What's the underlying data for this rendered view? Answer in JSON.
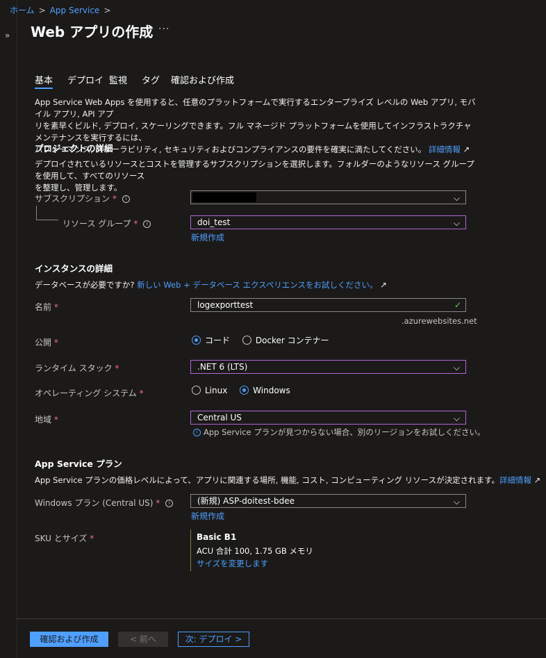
{
  "breadcrumb": {
    "home": "ホーム",
    "app_service": "App Service",
    "sep": ">"
  },
  "page": {
    "title": "Web アプリの作成",
    "more": "···"
  },
  "tabs": [
    {
      "label": "基本",
      "selected": true
    },
    {
      "label": "デプロイ"
    },
    {
      "label": "監視"
    },
    {
      "label": "タグ"
    },
    {
      "label": "確認および作成"
    }
  ],
  "intro": {
    "line1": "App Service Web Apps を使用すると、任意のプラットフォームで実行するエンタープライズ レベルの Web アプリ, モバイル アプリ, API アプ",
    "line2": "リを素早くビルド, デプロイ, スケーリングできます。フル マネージド プラットフォームを使用してインフラストラクチャ メンテナンスを実行するには、",
    "line3": "パフォーマンス, スケーラビリティ, セキュリティおよびコンプライアンスの要件を確実に満たしてください。",
    "learn_more": "詳細情報",
    "ext_icon": "↗"
  },
  "project": {
    "heading": "プロジェクトの詳細",
    "desc1": "デプロイされているリソースとコストを管理するサブスクリプションを選択します。フォルダーのようなリソース グループを使用して、すべてのリソース",
    "desc2": "を整理し、管理します。",
    "subscription_label": "サブスクリプション",
    "resource_group_label": "リソース グループ",
    "resource_group_value": "doi_test",
    "create_new": "新規作成"
  },
  "instance": {
    "heading": "インスタンスの詳細",
    "db_prompt": "データベースが必要ですか?",
    "db_link": "新しい Web + データベース エクスペリエンスをお試しください。",
    "name_label": "名前",
    "name_value": "logexporttest",
    "name_suffix": ".azurewebsites.net",
    "publish_label": "公開",
    "publish_options": [
      "コード",
      "Docker コンテナー"
    ],
    "runtime_label": "ランタイム スタック",
    "runtime_value": ".NET 6 (LTS)",
    "os_label": "オペレーティング システム",
    "os_options": [
      "Linux",
      "Windows"
    ],
    "region_label": "地域",
    "region_value": "Central US",
    "region_hint": "App Service プランが見つからない場合、別のリージョンをお試しください。"
  },
  "plan": {
    "heading": "App Service プラン",
    "desc": "App Service プランの価格レベルによって、アプリに関連する場所, 機能, コスト, コンピューティング リソースが決定されます。",
    "learn_more": "詳細情報",
    "windows_plan_label": "Windows プラン (Central US)",
    "windows_plan_value": "(新規) ASP-doitest-bdee",
    "create_new": "新規作成",
    "sku_label": "SKU とサイズ",
    "sku_name": "Basic B1",
    "sku_detail": "ACU 合計 100, 1.75 GB メモリ",
    "sku_change": "サイズを変更します"
  },
  "footer": {
    "review_create": "確認および作成",
    "previous": "< 前へ",
    "next": "次: デプロイ >"
  },
  "icons": {
    "required": "*",
    "info": "i",
    "chevron": "⌵",
    "check": "✓",
    "expand": "»"
  },
  "colors": {
    "accent": "#4f9fff",
    "required": "#f1707b",
    "focus_border": "#b165d8",
    "valid": "#6ccb5f"
  }
}
